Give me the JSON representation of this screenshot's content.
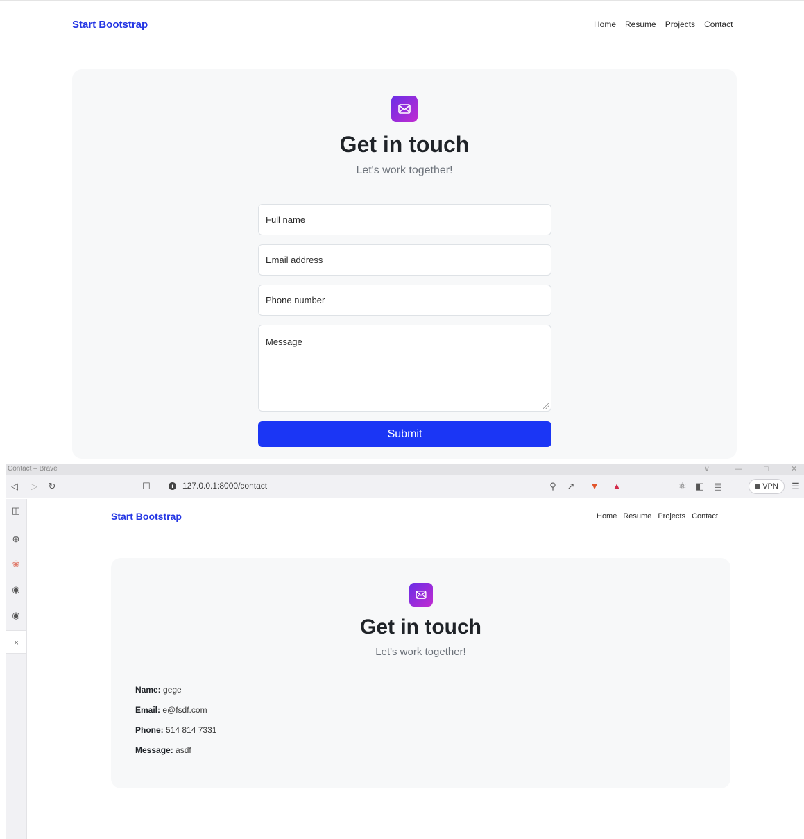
{
  "site": {
    "brand": "Start Bootstrap",
    "nav": [
      "Home",
      "Resume",
      "Projects",
      "Contact"
    ]
  },
  "contact": {
    "heading": "Get in touch",
    "subheading": "Let's work together!",
    "icon": "envelope-icon",
    "form": {
      "full_name_placeholder": "Full name",
      "email_placeholder": "Email address",
      "phone_placeholder": "Phone number",
      "message_placeholder": "Message",
      "submit_label": "Submit"
    }
  },
  "browser": {
    "window_title": "Contact – Brave",
    "url": "127.0.0.1:8000/contact",
    "vpn_label": "VPN",
    "close_sidebar_glyph": "×"
  },
  "result": {
    "name_label": "Name:",
    "name_value": "gege",
    "email_label": "Email:",
    "email_value": "e@fsdf.com",
    "phone_label": "Phone:",
    "phone_value": "514 814 7331",
    "message_label": "Message:",
    "message_value": "asdf"
  },
  "colors": {
    "brand": "#2436e4",
    "submit": "#1b36f5",
    "card_bg": "#f7f8f9",
    "icon_gradient_start": "#6a2ee6",
    "icon_gradient_end": "#c12bd1"
  }
}
